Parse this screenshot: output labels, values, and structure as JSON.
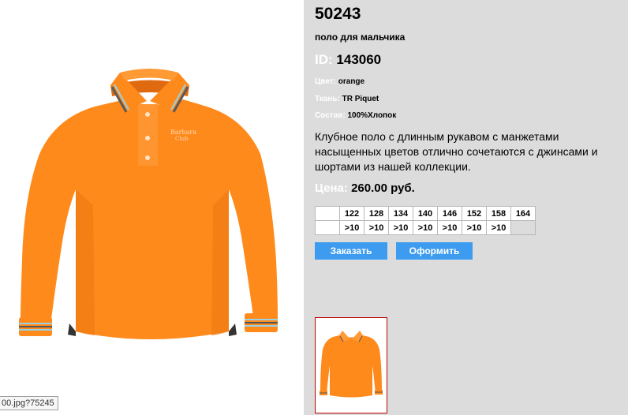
{
  "product": {
    "article": "50243",
    "subtitle": "поло для мальчика",
    "id_label": "ID:",
    "id_value": "143060",
    "color_label": "Цвет:",
    "color_value": "orange",
    "fabric_label": "Ткань:",
    "fabric_value": "TR Piquet",
    "composition_label": "Состав:",
    "composition_value": "100%Хлопок",
    "description": "Клубное поло с длинным рукавом с манжетами насыщенных цветов отлично сочетаются с джинсами и шортами из нашей коллекции.",
    "price_label": "Цена:",
    "price_value": "260.00 руб."
  },
  "sizes": {
    "header": [
      "122",
      "128",
      "134",
      "140",
      "146",
      "152",
      "158",
      "164"
    ],
    "stock": [
      ">10",
      ">10",
      ">10",
      ">10",
      ">10",
      ">10",
      ">10",
      ""
    ]
  },
  "buttons": {
    "order": "Заказать",
    "checkout": "Оформить"
  },
  "status_tip": "00.jpg?75245",
  "colors": {
    "panel_bg": "#dcdcdc",
    "button_bg": "#3e9cf0",
    "shirt": "#ff8a1c",
    "thumb_border": "#c00000"
  }
}
